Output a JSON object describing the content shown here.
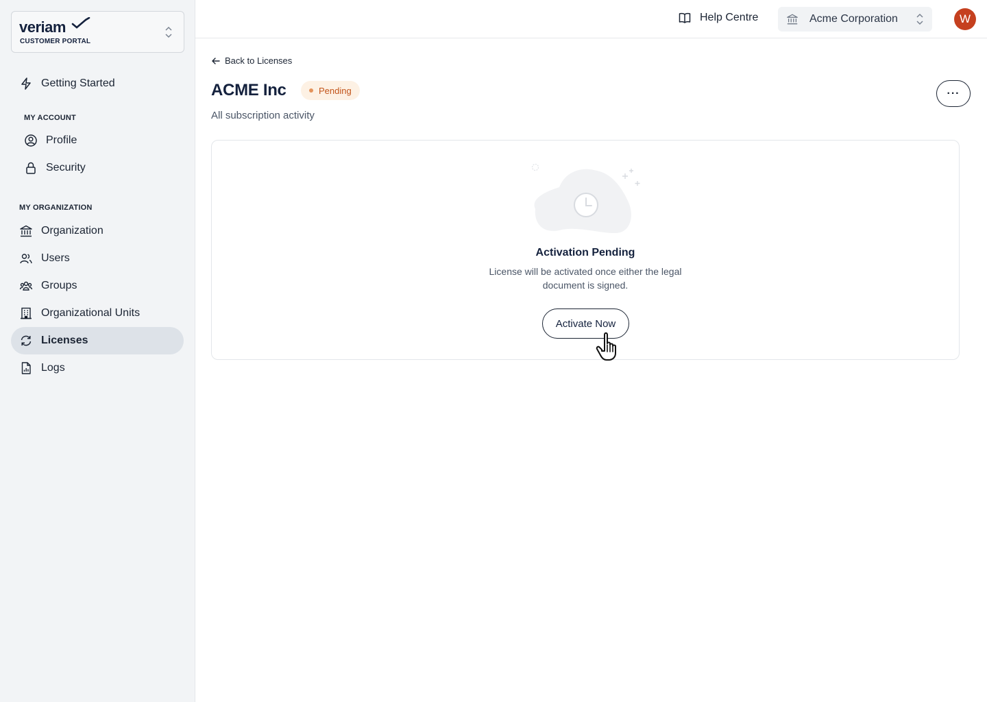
{
  "brand": {
    "name": "veriam",
    "subtitle": "CUSTOMER PORTAL"
  },
  "sidebar": {
    "getting_started": "Getting Started",
    "my_account_label": "MY ACCOUNT",
    "account_items": [
      {
        "label": "Profile",
        "icon": "user-circle-icon"
      },
      {
        "label": "Security",
        "icon": "lock-icon"
      }
    ],
    "my_org_label": "MY ORGANIZATION",
    "org_items": [
      {
        "label": "Organization",
        "icon": "bank-icon"
      },
      {
        "label": "Users",
        "icon": "users-icon"
      },
      {
        "label": "Groups",
        "icon": "groups-icon"
      },
      {
        "label": "Organizational Units",
        "icon": "building-icon"
      },
      {
        "label": "Licenses",
        "icon": "refresh-icon",
        "active": true
      },
      {
        "label": "Logs",
        "icon": "document-chart-icon"
      }
    ]
  },
  "topbar": {
    "help": "Help Centre",
    "org_name": "Acme Corporation",
    "avatar_initial": "W",
    "avatar_color": "#c5401f"
  },
  "page": {
    "back_link": "Back to Licenses",
    "title": "ACME Inc",
    "status": "Pending",
    "subtitle": "All subscription activity",
    "more_label": "···"
  },
  "empty_state": {
    "title": "Activation Pending",
    "description": "License will be activated once either the legal document is signed.",
    "button": "Activate Now"
  }
}
